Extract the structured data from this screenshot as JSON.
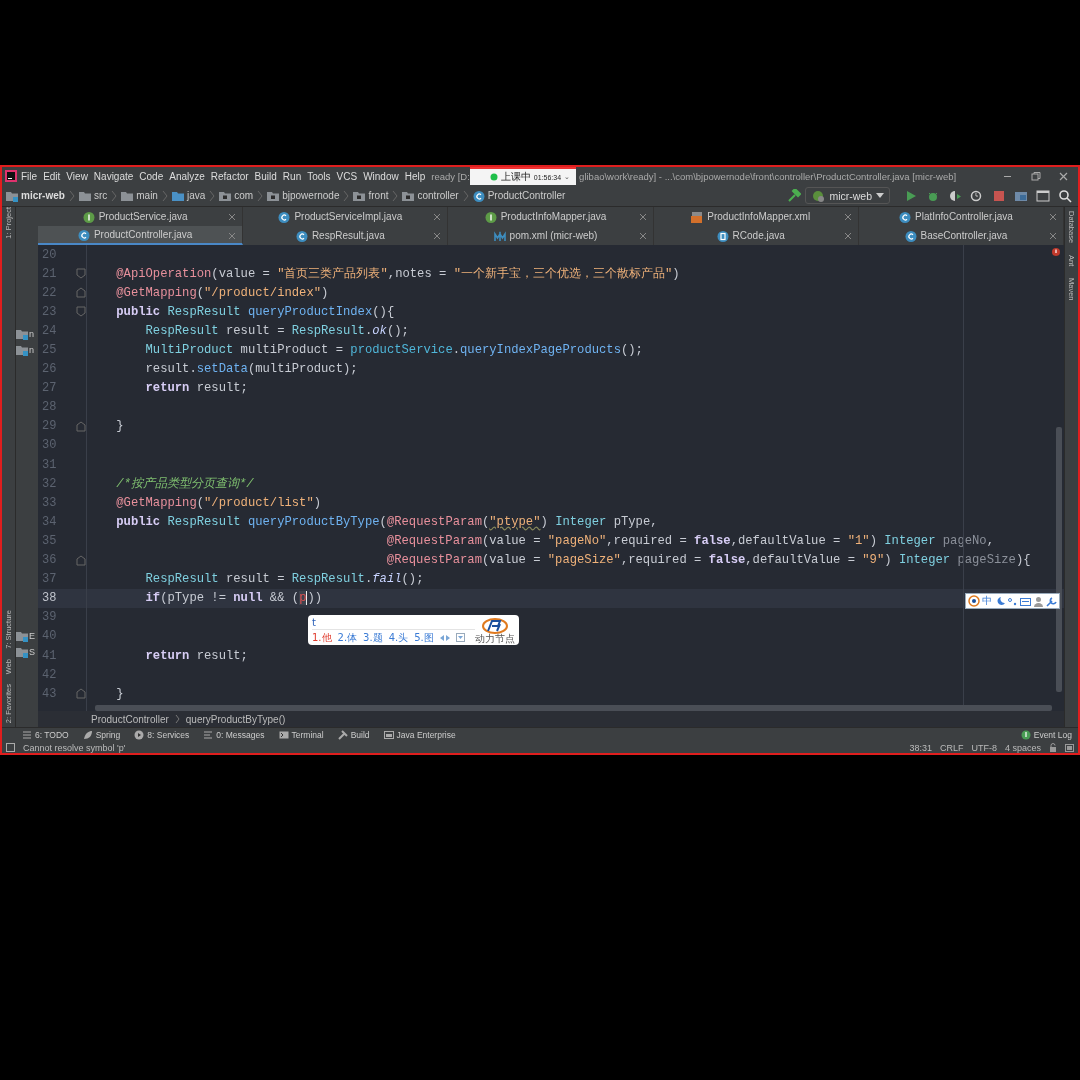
{
  "window": {
    "title_left": "ready [D:",
    "title_right": "glibao\\work\\ready] - ...\\com\\bjpowernode\\front\\controller\\ProductController.java [micr-web]"
  },
  "recording_widget": {
    "label": "上课中",
    "time": "01:56:34",
    "caret": "⌄"
  },
  "menu": [
    "File",
    "Edit",
    "View",
    "Navigate",
    "Code",
    "Analyze",
    "Refactor",
    "Build",
    "Run",
    "Tools",
    "VCS",
    "Window",
    "Help"
  ],
  "breadcrumb": [
    {
      "label": "micr-web",
      "kind": "module"
    },
    {
      "label": "src",
      "kind": "folder"
    },
    {
      "label": "main",
      "kind": "folder"
    },
    {
      "label": "java",
      "kind": "source"
    },
    {
      "label": "com",
      "kind": "package"
    },
    {
      "label": "bjpowernode",
      "kind": "package"
    },
    {
      "label": "front",
      "kind": "package"
    },
    {
      "label": "controller",
      "kind": "package"
    },
    {
      "label": "ProductController",
      "kind": "class"
    }
  ],
  "run_config": "micr-web",
  "tab_rows": [
    [
      {
        "label": "ProductService.java",
        "kind": "interface",
        "selected": false
      },
      {
        "label": "ProductServiceImpl.java",
        "kind": "class",
        "selected": false
      },
      {
        "label": "ProductInfoMapper.java",
        "kind": "interface",
        "selected": false
      },
      {
        "label": "ProductInfoMapper.xml",
        "kind": "xml",
        "selected": false
      },
      {
        "label": "PlatInfoController.java",
        "kind": "class",
        "selected": false
      }
    ],
    [
      {
        "label": "ProductController.java",
        "kind": "class",
        "selected": true
      },
      {
        "label": "RespResult.java",
        "kind": "class",
        "selected": false
      },
      {
        "label": "pom.xml (micr-web)",
        "kind": "maven",
        "selected": false
      },
      {
        "label": "RCode.java",
        "kind": "enum",
        "selected": false
      },
      {
        "label": "BaseController.java",
        "kind": "class",
        "selected": false
      }
    ]
  ],
  "left_tools": [
    "1: Project",
    "7: Structure",
    "Web",
    "2: Favorites"
  ],
  "right_tools": [
    "Database",
    "Ant",
    "Maven"
  ],
  "project_items": [
    "n",
    "n",
    "E",
    "S"
  ],
  "code_lines": [
    {
      "number": "20",
      "current": false,
      "fold_start": false,
      "fold_end": false
    },
    {
      "number": "21",
      "current": false,
      "fold_start": true,
      "fold_end": false,
      "tokens": [
        {
          "text": "    @ApiOperation",
          "kind": "ann"
        },
        {
          "text": "(value = "
        },
        {
          "text": "\"首页三类产品列表\"",
          "kind": "str"
        },
        {
          "text": ",notes = "
        },
        {
          "text": "\"一个新手宝，三个优选，三个散标产品\"",
          "kind": "str"
        },
        {
          "text": ")"
        }
      ]
    },
    {
      "number": "22",
      "current": false,
      "fold_start": false,
      "fold_end": true,
      "tokens": [
        {
          "text": "    @GetMapping",
          "kind": "ann"
        },
        {
          "text": "("
        },
        {
          "text": "\"/product/index\"",
          "kind": "str"
        },
        {
          "text": ")"
        }
      ]
    },
    {
      "number": "23",
      "current": false,
      "fold_start": true,
      "fold_end": false,
      "tokens": [
        {
          "text": "    public",
          "kind": "kw"
        },
        {
          "text": " RespResult",
          "kind": "type"
        },
        {
          "text": " queryProductIndex",
          "kind": "fn"
        },
        {
          "text": "(){"
        }
      ]
    },
    {
      "number": "24",
      "current": false,
      "fold_start": false,
      "fold_end": false,
      "tokens": [
        {
          "text": "        RespResult",
          "kind": "type"
        },
        {
          "text": " result = "
        },
        {
          "text": "RespResult",
          "kind": "type"
        },
        {
          "text": "."
        },
        {
          "text": "ok",
          "kind": "static"
        },
        {
          "text": "();"
        }
      ]
    },
    {
      "number": "25",
      "current": false,
      "fold_start": false,
      "fold_end": false,
      "tokens": [
        {
          "text": "        MultiProduct",
          "kind": "type"
        },
        {
          "text": " multiProduct = "
        },
        {
          "text": "productService",
          "kind": "field"
        },
        {
          "text": "."
        },
        {
          "text": "queryIndexPageProducts",
          "kind": "fn"
        },
        {
          "text": "();"
        }
      ]
    },
    {
      "number": "26",
      "current": false,
      "fold_start": false,
      "fold_end": false,
      "tokens": [
        {
          "text": "        result."
        },
        {
          "text": "setData",
          "kind": "fn"
        },
        {
          "text": "(multiProduct);"
        }
      ]
    },
    {
      "number": "27",
      "current": false,
      "fold_start": false,
      "fold_end": false,
      "tokens": [
        {
          "text": "        return",
          "kind": "kw"
        },
        {
          "text": " result;"
        }
      ]
    },
    {
      "number": "28",
      "current": false,
      "fold_start": false,
      "fold_end": false
    },
    {
      "number": "29",
      "current": false,
      "fold_start": false,
      "fold_end": true,
      "tokens": [
        {
          "text": "    }"
        }
      ]
    },
    {
      "number": "30",
      "current": false,
      "fold_start": false,
      "fold_end": false
    },
    {
      "number": "31",
      "current": false,
      "fold_start": false,
      "fold_end": false
    },
    {
      "number": "32",
      "current": false,
      "fold_start": false,
      "fold_end": false,
      "tokens": [
        {
          "text": "    /*按产品类型分页查询*/",
          "kind": "cmt"
        }
      ]
    },
    {
      "number": "33",
      "current": false,
      "fold_start": false,
      "fold_end": false,
      "tokens": [
        {
          "text": "    @GetMapping",
          "kind": "ann"
        },
        {
          "text": "("
        },
        {
          "text": "\"/product/list\"",
          "kind": "str"
        },
        {
          "text": ")"
        }
      ]
    },
    {
      "number": "34",
      "current": false,
      "fold_start": false,
      "fold_end": false,
      "tokens": [
        {
          "text": "    public",
          "kind": "kw"
        },
        {
          "text": " RespResult",
          "kind": "type"
        },
        {
          "text": " queryProductByType",
          "kind": "fn"
        },
        {
          "text": "("
        },
        {
          "text": "@RequestParam",
          "kind": "ann"
        },
        {
          "text": "("
        },
        {
          "text": "\"ptype\"",
          "kind": "typo"
        },
        {
          "text": ") "
        },
        {
          "text": "Integer",
          "kind": "type"
        },
        {
          "text": " pType,"
        }
      ]
    },
    {
      "number": "35",
      "current": false,
      "fold_start": false,
      "fold_end": false,
      "tokens": [
        {
          "text": "                                         @RequestParam",
          "kind": "ann"
        },
        {
          "text": "(value = "
        },
        {
          "text": "\"pageNo\"",
          "kind": "str"
        },
        {
          "text": ",required = "
        },
        {
          "text": "false",
          "kind": "kw"
        },
        {
          "text": ",defaultValue = "
        },
        {
          "text": "\"1\"",
          "kind": "str"
        },
        {
          "text": ") "
        },
        {
          "text": "Integer",
          "kind": "type"
        },
        {
          "text": " pageNo",
          "kind": "unused"
        },
        {
          "text": ","
        }
      ]
    },
    {
      "number": "36",
      "current": false,
      "fold_start": false,
      "fold_end": true,
      "tokens": [
        {
          "text": "                                         @RequestParam",
          "kind": "ann"
        },
        {
          "text": "(value = "
        },
        {
          "text": "\"pageSize\"",
          "kind": "str"
        },
        {
          "text": ",required = "
        },
        {
          "text": "false",
          "kind": "kw"
        },
        {
          "text": ",defaultValue = "
        },
        {
          "text": "\"9\"",
          "kind": "str"
        },
        {
          "text": ") "
        },
        {
          "text": "Integer",
          "kind": "type"
        },
        {
          "text": " pageSize",
          "kind": "unused"
        },
        {
          "text": "){"
        }
      ]
    },
    {
      "number": "37",
      "current": false,
      "fold_start": false,
      "fold_end": false,
      "tokens": [
        {
          "text": "        RespResult",
          "kind": "type"
        },
        {
          "text": " result = "
        },
        {
          "text": "RespResult",
          "kind": "type"
        },
        {
          "text": "."
        },
        {
          "text": "fail",
          "kind": "static"
        },
        {
          "text": "();"
        }
      ]
    },
    {
      "number": "38",
      "current": true,
      "fold_start": false,
      "fold_end": false,
      "tokens": [
        {
          "text": "        if",
          "kind": "kw"
        },
        {
          "text": "(pType != "
        },
        {
          "text": "null",
          "kind": "kw"
        },
        {
          "text": " && ("
        },
        {
          "text": "p",
          "kind": "err",
          "caret": true
        },
        {
          "text": "))"
        }
      ]
    },
    {
      "number": "39",
      "current": false,
      "fold_start": false,
      "fold_end": false
    },
    {
      "number": "40",
      "current": false,
      "fold_start": false,
      "fold_end": false
    },
    {
      "number": "41",
      "current": false,
      "fold_start": false,
      "fold_end": false,
      "tokens": [
        {
          "text": "        return",
          "kind": "kw"
        },
        {
          "text": " result;"
        }
      ]
    },
    {
      "number": "42",
      "current": false,
      "fold_start": false,
      "fold_end": false
    },
    {
      "number": "43",
      "current": false,
      "fold_start": false,
      "fold_end": true,
      "tokens": [
        {
          "text": "    }"
        }
      ]
    }
  ],
  "ime_popup": {
    "input": "t",
    "candidates": [
      {
        "text": "1.他",
        "selected": true
      },
      {
        "text": "2.体",
        "selected": false
      },
      {
        "text": "3.题",
        "selected": false
      },
      {
        "text": "4.头",
        "selected": false
      },
      {
        "text": "5.图",
        "selected": false
      }
    ],
    "logo_text": "动力节点"
  },
  "ime_status": {
    "mode": "中"
  },
  "editor_breadcrumb": [
    "ProductController",
    "queryProductByType()"
  ],
  "tool_windows": [
    {
      "label": "6: TODO",
      "kind": "todo"
    },
    {
      "label": "Spring",
      "kind": "spring"
    },
    {
      "label": "8: Services",
      "kind": "services"
    },
    {
      "label": "0: Messages",
      "kind": "messages"
    },
    {
      "label": "Terminal",
      "kind": "terminal"
    },
    {
      "label": "Build",
      "kind": "build"
    },
    {
      "label": "Java Enterprise",
      "kind": "enterprise"
    }
  ],
  "event_log": "Event Log",
  "status_bar": {
    "message": "Cannot resolve symbol 'p'",
    "position": "38:31",
    "line_separator": "CRLF",
    "encoding": "UTF-8",
    "indent": "4 spaces"
  }
}
